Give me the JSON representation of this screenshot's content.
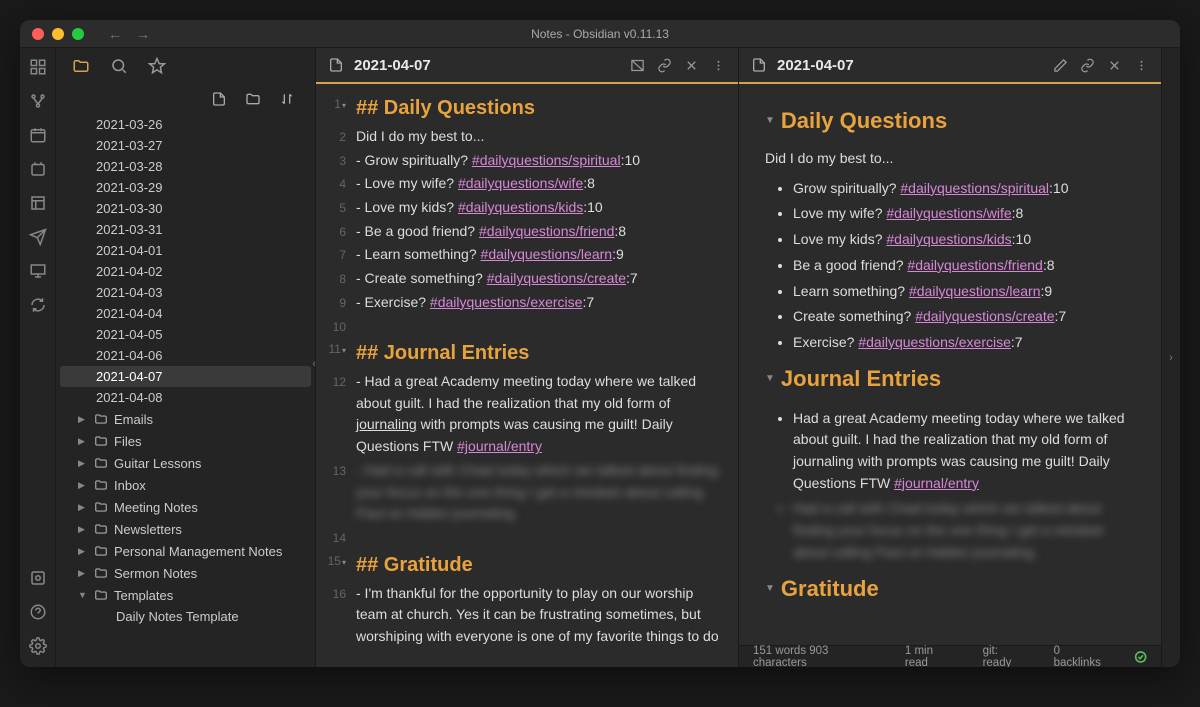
{
  "window_title": "Notes - Obsidian v0.11.13",
  "active_note": "2021-04-07",
  "daily_notes": [
    "2021-03-26",
    "2021-03-27",
    "2021-03-28",
    "2021-03-29",
    "2021-03-30",
    "2021-03-31",
    "2021-04-01",
    "2021-04-02",
    "2021-04-03",
    "2021-04-04",
    "2021-04-05",
    "2021-04-06",
    "2021-04-07",
    "2021-04-08"
  ],
  "selected_note": "2021-04-07",
  "folders": [
    {
      "name": "Emails",
      "open": false
    },
    {
      "name": "Files",
      "open": false
    },
    {
      "name": "Guitar Lessons",
      "open": false
    },
    {
      "name": "Inbox",
      "open": false
    },
    {
      "name": "Meeting Notes",
      "open": false
    },
    {
      "name": "Newsletters",
      "open": false
    },
    {
      "name": "Personal Management Notes",
      "open": false
    },
    {
      "name": "Sermon Notes",
      "open": false
    },
    {
      "name": "Templates",
      "open": true,
      "children": [
        "Daily Notes Template"
      ]
    }
  ],
  "editor": {
    "h_daily": "## Daily Questions",
    "intro": "Did I do my best to...",
    "questions": [
      {
        "label": "Grow spiritually?",
        "tag": "#dailyquestions/spiritual",
        "score": ":10"
      },
      {
        "label": "Love my wife?",
        "tag": "#dailyquestions/wife",
        "score": ":8"
      },
      {
        "label": "Love my kids?",
        "tag": "#dailyquestions/kids",
        "score": ":10"
      },
      {
        "label": "Be a good friend?",
        "tag": "#dailyquestions/friend",
        "score": ":8"
      },
      {
        "label": "Learn something?",
        "tag": "#dailyquestions/learn",
        "score": ":9"
      },
      {
        "label": "Create something?",
        "tag": "#dailyquestions/create",
        "score": ":7"
      },
      {
        "label": "Exercise?",
        "tag": "#dailyquestions/exercise",
        "score": ":7"
      }
    ],
    "h_journal": "## Journal Entries",
    "journal_1a": "Had a great Academy meeting today where we talked about guilt. I had the realization that my old form of ",
    "journal_1b": "journaling",
    "journal_1c": " with prompts was causing me guilt! Daily Questions FTW ",
    "journal_tag": "#journal/entry",
    "journal_blur": "Had a call with Chad today which we talked about finding your focus on the one thing I get a mindset about calling Paul on hidden journaling.",
    "h_grat": "## Gratitude",
    "grat_1": "I'm thankful for the opportunity to play on our worship team at church. Yes it can be frustrating sometimes, but worshiping with everyone is one of my favorite things to do"
  },
  "preview": {
    "h_daily": "Daily Questions",
    "h_journal": "Journal Entries",
    "h_grat": "Gratitude"
  },
  "status": {
    "words": "151 words 903 characters",
    "read": "1 min read",
    "git": "git: ready",
    "backlinks": "0 backlinks"
  }
}
